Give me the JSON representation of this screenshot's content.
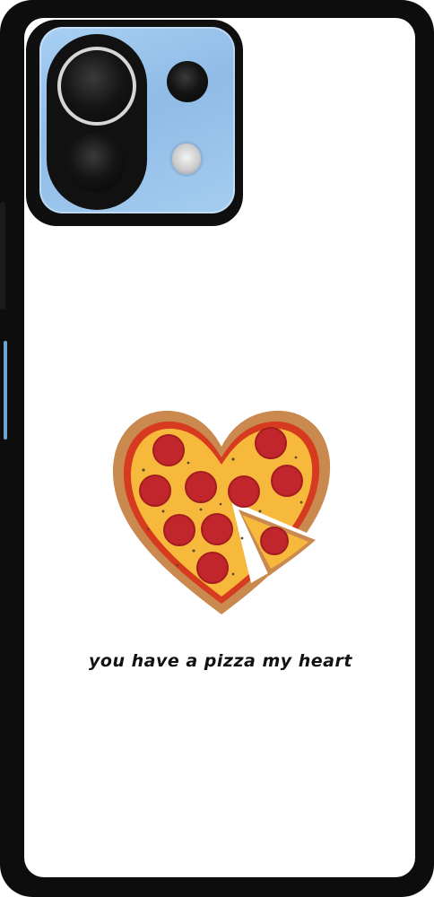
{
  "product": {
    "caption": "you have a pizza my heart",
    "colors": {
      "case_frame": "#0d0d0d",
      "camera_plate": "#a9d0f3",
      "crust": "#c9894f",
      "cheese": "#f6b93b",
      "sauce": "#d63a1f",
      "pepperoni": "#c0262b"
    },
    "icons": {
      "artwork": "pizza-heart-icon",
      "main_lens": "camera-lens-icon",
      "secondary_lens": "camera-lens-icon",
      "flash": "flash-icon"
    }
  }
}
